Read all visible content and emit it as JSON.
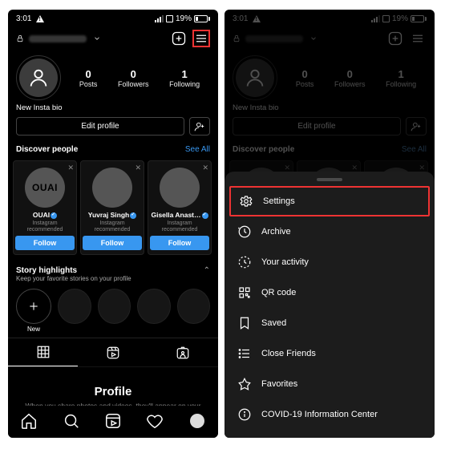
{
  "status": {
    "time": "3:01",
    "battery_pct": "19%"
  },
  "header": {
    "addpost_icon": "plus-square",
    "menu_icon": "menu"
  },
  "profile": {
    "bio": "New Insta bio",
    "stats": [
      {
        "n": "0",
        "l": "Posts"
      },
      {
        "n": "0",
        "l": "Followers"
      },
      {
        "n": "1",
        "l": "Following"
      }
    ],
    "edit_label": "Edit profile"
  },
  "discover": {
    "title": "Discover people",
    "see_all": "See All",
    "cards": [
      {
        "name": "OUAI",
        "sub": "Instagram\nrecommended",
        "follow": "Follow",
        "pic": "ouai"
      },
      {
        "name": "Yuvraj Singh",
        "sub": "Instagram\nrecommended",
        "follow": "Follow",
        "pic": "man"
      },
      {
        "name": "Gisella Anast…",
        "sub": "Instagram\nrecommended",
        "follow": "Follow",
        "pic": "girl"
      }
    ]
  },
  "story": {
    "title": "Story highlights",
    "desc": "Keep your favorite stories on your profile",
    "new_label": "New"
  },
  "empty": {
    "heading": "Profile",
    "body": "When you share photos and videos, they'll appear on\nyour profile."
  },
  "menu": {
    "items": [
      {
        "icon": "gear",
        "label": "Settings",
        "hl": true
      },
      {
        "icon": "clock",
        "label": "Archive"
      },
      {
        "icon": "activity",
        "label": "Your activity"
      },
      {
        "icon": "qr",
        "label": "QR code"
      },
      {
        "icon": "bookmark",
        "label": "Saved"
      },
      {
        "icon": "list",
        "label": "Close Friends"
      },
      {
        "icon": "star",
        "label": "Favorites"
      },
      {
        "icon": "info",
        "label": "COVID-19 Information Center"
      }
    ]
  }
}
